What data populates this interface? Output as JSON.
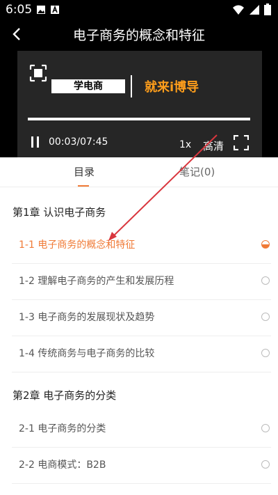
{
  "status_bar": {
    "time": "6:05",
    "left_icons": [
      "image-icon",
      "a-icon"
    ],
    "right_icons": [
      "wifi-icon",
      "signal-icon",
      "battery-icon"
    ]
  },
  "player": {
    "title": "电子商务的概念和特征",
    "slide_left_text": "学电商",
    "slide_right_text": "就来i博导",
    "current_time": "00:03",
    "separator": "/",
    "duration": "07:45",
    "time_display": "00:03/07:45",
    "progress_fraction": 0.006,
    "speed": "1x",
    "quality": "高清"
  },
  "tabs": [
    {
      "label": "目录",
      "active": true
    },
    {
      "label": "笔记(0)",
      "active": false
    }
  ],
  "chapters": [
    {
      "title": "第1章 认识电子商务",
      "lessons": [
        {
          "label": "1-1 电子商务的概念和特征",
          "state": "in-progress"
        },
        {
          "label": "1-2 理解电子商务的产生和发展历程",
          "state": "not-started"
        },
        {
          "label": "1-3 电子商务的发展现状及趋势",
          "state": "not-started"
        },
        {
          "label": "1-4 传统商务与电子商务的比较",
          "state": "not-started"
        }
      ]
    },
    {
      "title": "第2章 电子商务的分类",
      "lessons": [
        {
          "label": "2-1 电子商务的分类",
          "state": "not-started"
        },
        {
          "label": "2-2 电商模式：B2B",
          "state": "not-started"
        }
      ]
    }
  ],
  "colors": {
    "accent": "#f07a36",
    "annotation_arrow": "#d9363e",
    "slide_brand": "#ff9e1b"
  }
}
